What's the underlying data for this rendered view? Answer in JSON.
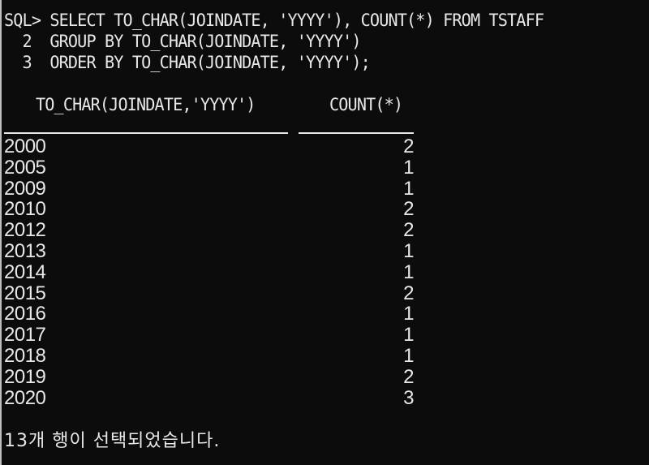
{
  "terminal": {
    "query_lines": [
      "SQL> SELECT TO_CHAR(JOINDATE, 'YYYY'), COUNT(*) FROM TSTAFF",
      "  2  GROUP BY TO_CHAR(JOINDATE, 'YYYY')",
      "  3  ORDER BY TO_CHAR(JOINDATE, 'YYYY');"
    ],
    "columns": [
      "TO_CHAR(JOINDATE,'YYYY')",
      "COUNT(*)"
    ],
    "rows": [
      {
        "year": "2000",
        "count": "2"
      },
      {
        "year": "2005",
        "count": "1"
      },
      {
        "year": "2009",
        "count": "1"
      },
      {
        "year": "2010",
        "count": "2"
      },
      {
        "year": "2012",
        "count": "2"
      },
      {
        "year": "2013",
        "count": "1"
      },
      {
        "year": "2014",
        "count": "1"
      },
      {
        "year": "2015",
        "count": "2"
      },
      {
        "year": "2016",
        "count": "1"
      },
      {
        "year": "2017",
        "count": "1"
      },
      {
        "year": "2018",
        "count": "1"
      },
      {
        "year": "2019",
        "count": "2"
      },
      {
        "year": "2020",
        "count": "3"
      }
    ],
    "status": "13개 행이 선택되었습니다."
  }
}
